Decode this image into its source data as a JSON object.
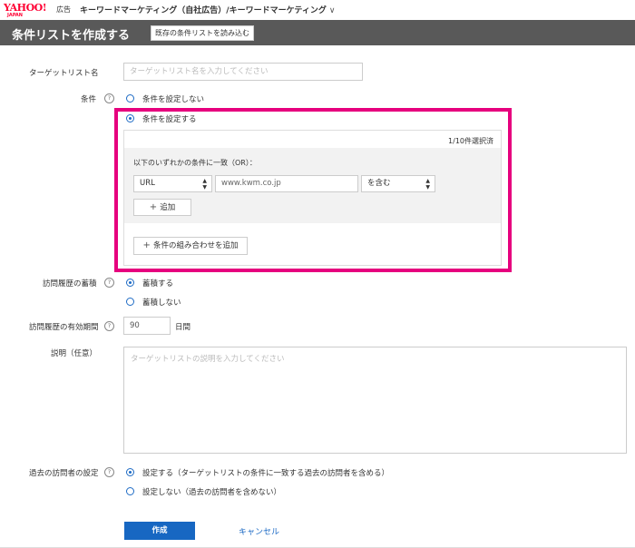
{
  "brand": {
    "logo_text": "YAHOO!",
    "logo_sub": "JAPAN",
    "ad_label": "広告",
    "accent": "#ff0033"
  },
  "breadcrumb": {
    "text": "キーワードマーケティング（自社広告）/キーワードマーケティング",
    "chevron_icon": "chevron-down-icon"
  },
  "header": {
    "title": "条件リストを作成する",
    "load_button": "既存の条件リストを読み込む",
    "bg": "#595959"
  },
  "form": {
    "target_list_name": {
      "label": "ターゲットリスト名",
      "placeholder": "ターゲットリスト名を入力してください",
      "value": ""
    },
    "condition": {
      "label": "条件",
      "help_icon": "?",
      "options": [
        {
          "label": "条件を設定しない",
          "checked": false
        },
        {
          "label": "条件を設定する",
          "checked": true
        }
      ],
      "selected_count": "1/10件選択済",
      "match_label": "以下のいずれかの条件に一致（OR）：",
      "rule": {
        "field": "URL",
        "value": "www.kwm.co.jp",
        "operator": "を含む"
      },
      "add_button": "追加",
      "add_combination_button": "条件の組み合わせを追加"
    },
    "history_accumulate": {
      "label": "訪問履歴の蓄積",
      "help_icon": "?",
      "options": [
        {
          "label": "蓄積する",
          "checked": true
        },
        {
          "label": "蓄積しない",
          "checked": false
        }
      ]
    },
    "validity_period": {
      "label": "訪問履歴の有効期間",
      "help_icon": "?",
      "value": "90",
      "unit": "日間"
    },
    "description": {
      "label": "説明（任意）",
      "placeholder": "ターゲットリストの説明を入力してください"
    },
    "past_visitors": {
      "label": "過去の訪問者の設定",
      "help_icon": "?",
      "options": [
        {
          "label": "設定する（ターゲットリストの条件に一致する過去の訪問者を含める）",
          "checked": true
        },
        {
          "label": "設定しない（過去の訪問者を含めない）",
          "checked": false
        }
      ]
    }
  },
  "actions": {
    "create_label": "作成",
    "cancel_label": "キャンセル",
    "primary_color": "#1767c2"
  },
  "highlight_color": "#e6007e"
}
